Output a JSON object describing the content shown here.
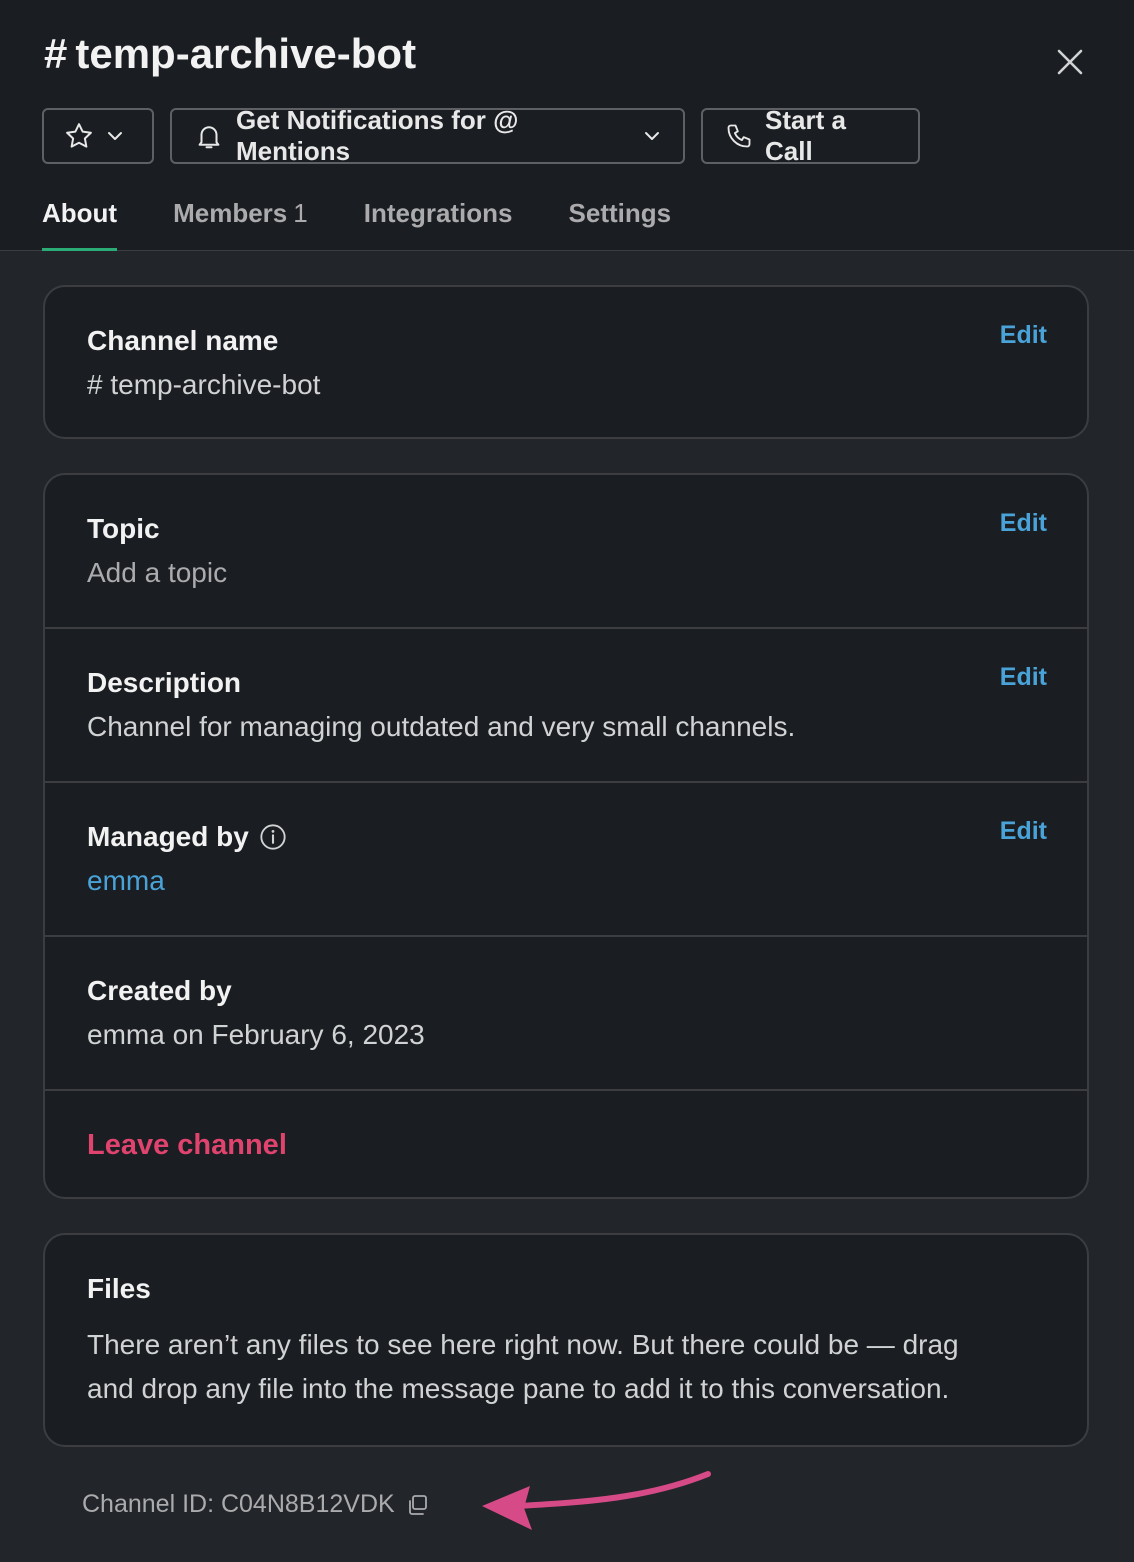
{
  "header": {
    "hash": "#",
    "title": "temp-archive-bot",
    "notifications_label": "Get Notifications for @ Mentions",
    "call_label": "Start a Call"
  },
  "tabs": [
    {
      "label": "About",
      "active": true
    },
    {
      "label": "Members",
      "count": "1"
    },
    {
      "label": "Integrations"
    },
    {
      "label": "Settings"
    }
  ],
  "about": {
    "channel_name": {
      "label": "Channel name",
      "value": "# temp-archive-bot",
      "edit": "Edit"
    },
    "topic": {
      "label": "Topic",
      "value": "Add a topic",
      "edit": "Edit"
    },
    "description": {
      "label": "Description",
      "value": "Channel for managing outdated and very small channels.",
      "edit": "Edit"
    },
    "managed_by": {
      "label": "Managed by",
      "value": "emma",
      "edit": "Edit"
    },
    "created_by": {
      "label": "Created by",
      "value": "emma on February 6, 2023"
    },
    "leave": "Leave channel"
  },
  "files": {
    "label": "Files",
    "text_line1": "There aren’t any files to see here right now. But there could be — drag",
    "text_line2": "and drop any file into the message pane to add it to this conversation."
  },
  "channel_id": {
    "text": "Channel ID: C04N8B12VDK"
  },
  "colors": {
    "accent_link": "#4aa3d8",
    "danger": "#e0436e",
    "tab_underline": "#2bac76",
    "annotation_arrow": "#d64a87"
  },
  "icons": [
    "star-icon",
    "chevron-down-icon",
    "bell-icon",
    "phone-icon",
    "close-icon",
    "info-icon",
    "copy-icon",
    "annotation-arrow"
  ]
}
